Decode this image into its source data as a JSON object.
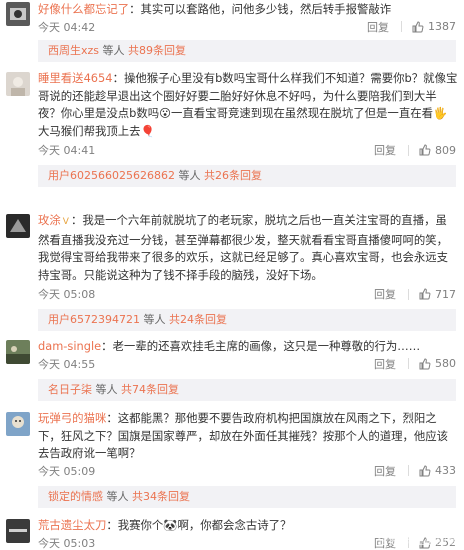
{
  "comments": [
    {
      "user": "好像什么都忘记了",
      "text": "：其实可以套路他，问他多少钱，然后转手报警敲诈",
      "time": "今天 04:42",
      "reply": "回复",
      "likes": "1387",
      "sub": {
        "name": "西周生xzs",
        "mid": " 等人 ",
        "count": "共89条回复"
      }
    },
    {
      "user": "睡里看送4654",
      "text": "：操他猴子心里没有b数吗宝哥什么样我们不知道？需要你b？就像宝哥说的还能趁早退出这个圈好好要二胎好好休息不好吗，为什么要陪我们到大半夜？你心里是没点b数吗😮一直看宝哥竞速到现在虽然现在脱坑了但是一直在看🖐大马猴们帮我顶上去🎈",
      "time": "今天 04:41",
      "reply": "回复",
      "likes": "809",
      "sub": {
        "name": "用户6025660256268​62",
        "mid": " 等人 ",
        "count": "共26条回复"
      }
    },
    {
      "user": "玫涂",
      "text": "：我是一个六年前就脱坑了的老玩家，脱坑之后也一直关注宝哥的直播，虽然看直播我没充过一分钱，甚至弹幕都很少发，整天就看看宝哥直播傻呵呵的笑，我觉得宝哥给我带来了很多的欢乐，这就已经足够了。真心喜欢宝哥，也会永远支持宝哥。只能说这种为了钱不择手段的脑残，没好下场。",
      "time": "今天 05:08",
      "reply": "回复",
      "likes": "717",
      "sub": {
        "name": "用户6572394721",
        "mid": " 等人 ",
        "count": "共24条回复"
      }
    },
    {
      "user": "dam-single",
      "text": "：老一辈的还喜欢挂毛主席的画像，这只是一种尊敬的行为……",
      "time": "今天 04:55",
      "reply": "回复",
      "likes": "580",
      "sub": {
        "name": "名日子柒",
        "mid": " 等人 ",
        "count": "共74条回复"
      }
    },
    {
      "user": "玩弹弓的猫咪",
      "text": "：这都能黑？那他要不要告政府机构把国旗放在风雨之下，烈阳之下，狂风之下？国旗是国家尊严，却放在外面任其摧残？按那个人的道理，他应该去告政府讹一笔啊？",
      "time": "今天 05:09",
      "reply": "回复",
      "likes": "433",
      "sub": {
        "name": "锁定的情感",
        "mid": " 等人 ",
        "count": "共34条回复"
      }
    },
    {
      "user": "荒古遗尘太刀",
      "text": "：我赛你个🐼啊，你都会念古诗了？",
      "time": "今天 05:03",
      "reply": "回复",
      "likes": "252"
    }
  ],
  "watermark": "企鹅号 皇爵阿赛"
}
